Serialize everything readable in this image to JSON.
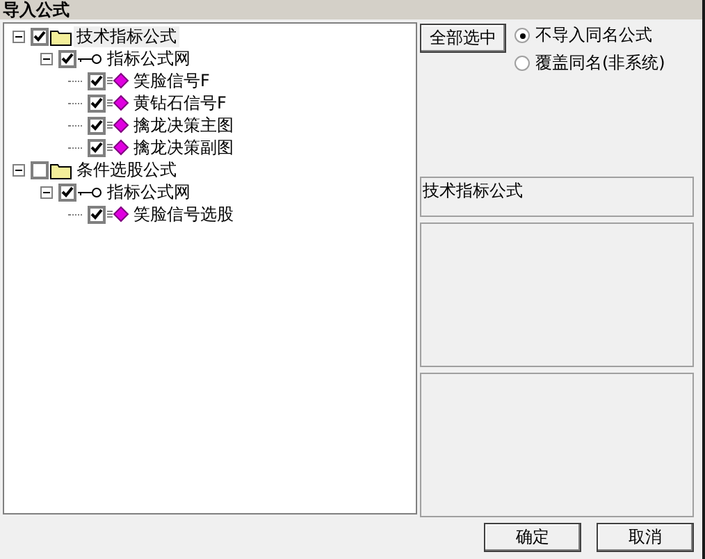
{
  "window": {
    "title": "导入公式"
  },
  "tree": [
    {
      "label": "技术指标公式",
      "kind": "folder",
      "checked": true,
      "expanded": true,
      "selected": true,
      "children": [
        {
          "label": "指标公式网",
          "kind": "key",
          "checked": true,
          "expanded": true,
          "selected": false,
          "children": [
            {
              "label": "笑脸信号F",
              "kind": "formula",
              "checked": true,
              "selected": false
            },
            {
              "label": "黄钻石信号F",
              "kind": "formula",
              "checked": true,
              "selected": false
            },
            {
              "label": "擒龙决策主图",
              "kind": "formula",
              "checked": true,
              "selected": false
            },
            {
              "label": "擒龙决策副图",
              "kind": "formula",
              "checked": true,
              "selected": false
            }
          ]
        }
      ]
    },
    {
      "label": "条件选股公式",
      "kind": "folder",
      "checked": false,
      "expanded": true,
      "selected": false,
      "children": [
        {
          "label": "指标公式网",
          "kind": "key",
          "checked": true,
          "expanded": true,
          "selected": false,
          "children": [
            {
              "label": "笑脸信号选股",
              "kind": "formula",
              "checked": true,
              "selected": false
            }
          ]
        }
      ]
    }
  ],
  "select_all_button": "全部选中",
  "options": [
    {
      "label": "不导入同名公式",
      "selected": true
    },
    {
      "label": "覆盖同名(非系统)",
      "selected": false
    }
  ],
  "category_box": {
    "value": "技术指标公式"
  },
  "buttons": [
    "确定",
    "取消"
  ]
}
